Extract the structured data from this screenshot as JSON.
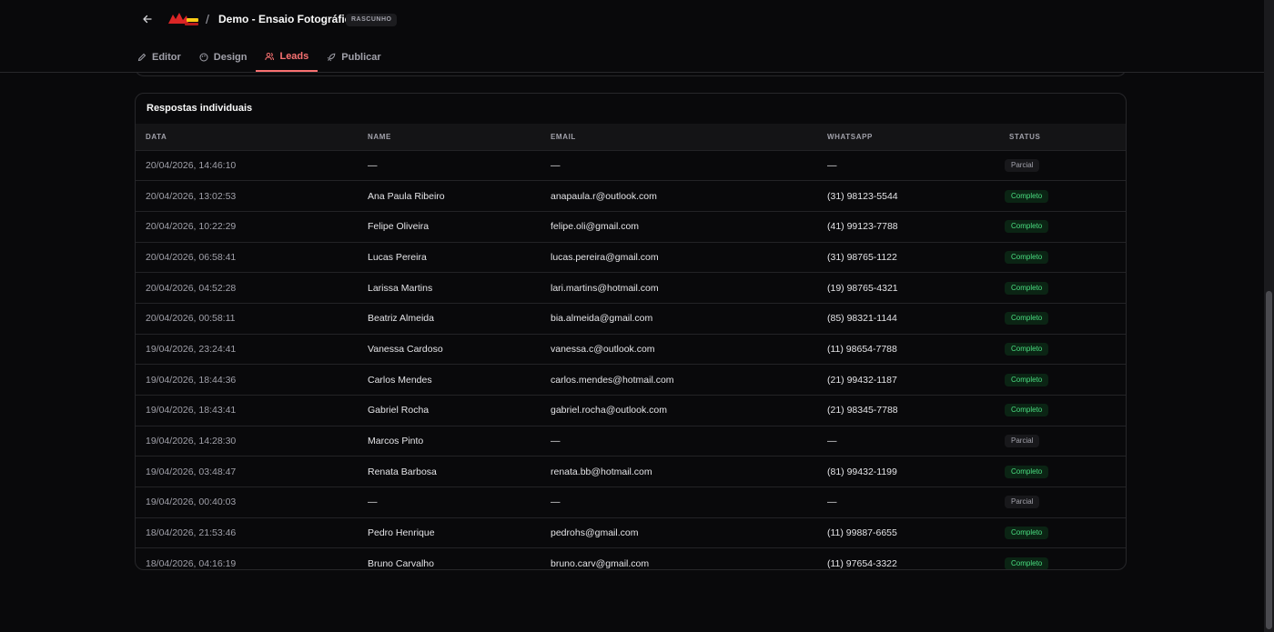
{
  "header": {
    "project_title": "Demo - Ensaio Fotográfico",
    "status_badge": "RASCUNHO",
    "separator": "/"
  },
  "tabs": [
    {
      "label": "Editor",
      "icon": "pencil-icon",
      "active": false
    },
    {
      "label": "Design",
      "icon": "palette-icon",
      "active": false
    },
    {
      "label": "Leads",
      "icon": "users-icon",
      "active": true
    },
    {
      "label": "Publicar",
      "icon": "rocket-icon",
      "active": false
    }
  ],
  "responses": {
    "title": "Respostas individuais",
    "columns": [
      "DATA",
      "NAME",
      "EMAIL",
      "WHATSAPP",
      "STATUS"
    ],
    "rows": [
      {
        "date": "20/04/2026, 14:46:10",
        "name": "—",
        "email": "—",
        "whatsapp": "—",
        "status": "Parcial"
      },
      {
        "date": "20/04/2026, 13:02:53",
        "name": "Ana Paula Ribeiro",
        "email": "anapaula.r@outlook.com",
        "whatsapp": "(31) 98123-5544",
        "status": "Completo"
      },
      {
        "date": "20/04/2026, 10:22:29",
        "name": "Felipe Oliveira",
        "email": "felipe.oli@gmail.com",
        "whatsapp": "(41) 99123-7788",
        "status": "Completo"
      },
      {
        "date": "20/04/2026, 06:58:41",
        "name": "Lucas Pereira",
        "email": "lucas.pereira@gmail.com",
        "whatsapp": "(31) 98765-1122",
        "status": "Completo"
      },
      {
        "date": "20/04/2026, 04:52:28",
        "name": "Larissa Martins",
        "email": "lari.martins@hotmail.com",
        "whatsapp": "(19) 98765-4321",
        "status": "Completo"
      },
      {
        "date": "20/04/2026, 00:58:11",
        "name": "Beatriz Almeida",
        "email": "bia.almeida@gmail.com",
        "whatsapp": "(85) 98321-1144",
        "status": "Completo"
      },
      {
        "date": "19/04/2026, 23:24:41",
        "name": "Vanessa Cardoso",
        "email": "vanessa.c@outlook.com",
        "whatsapp": "(11) 98654-7788",
        "status": "Completo"
      },
      {
        "date": "19/04/2026, 18:44:36",
        "name": "Carlos Mendes",
        "email": "carlos.mendes@hotmail.com",
        "whatsapp": "(21) 99432-1187",
        "status": "Completo"
      },
      {
        "date": "19/04/2026, 18:43:41",
        "name": "Gabriel Rocha",
        "email": "gabriel.rocha@outlook.com",
        "whatsapp": "(21) 98345-7788",
        "status": "Completo"
      },
      {
        "date": "19/04/2026, 14:28:30",
        "name": "Marcos Pinto",
        "email": "—",
        "whatsapp": "—",
        "status": "Parcial"
      },
      {
        "date": "19/04/2026, 03:48:47",
        "name": "Renata Barbosa",
        "email": "renata.bb@hotmail.com",
        "whatsapp": "(81) 99432-1199",
        "status": "Completo"
      },
      {
        "date": "19/04/2026, 00:40:03",
        "name": "—",
        "email": "—",
        "whatsapp": "—",
        "status": "Parcial"
      },
      {
        "date": "18/04/2026, 21:53:46",
        "name": "Pedro Henrique",
        "email": "pedrohs@gmail.com",
        "whatsapp": "(11) 99887-6655",
        "status": "Completo"
      },
      {
        "date": "18/04/2026, 04:16:19",
        "name": "Bruno Carvalho",
        "email": "bruno.carv@gmail.com",
        "whatsapp": "(11) 97654-3322",
        "status": "Completo"
      }
    ]
  },
  "colors": {
    "background": "#09090b",
    "accent": "#f87171",
    "complete": "#4ade80"
  }
}
